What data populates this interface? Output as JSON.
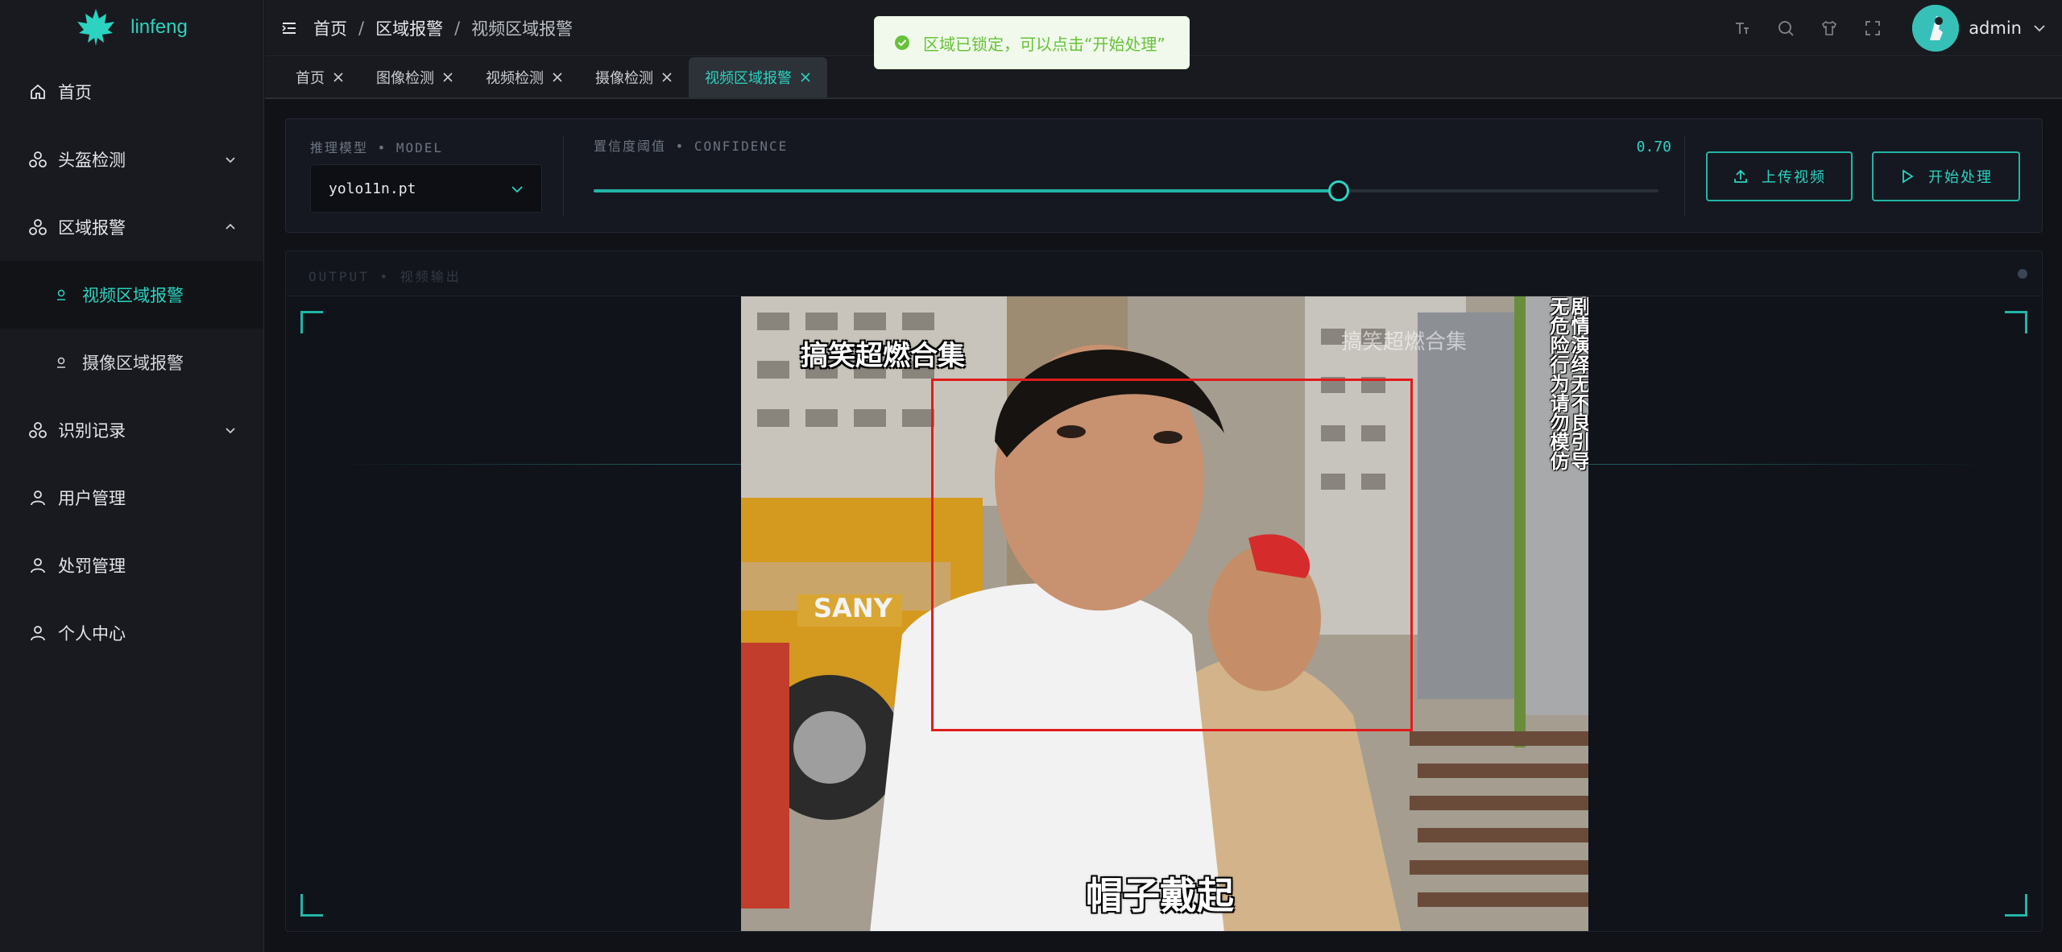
{
  "app": {
    "name": "linfeng",
    "accent": "#2bd3c0"
  },
  "sidebar": {
    "items": [
      {
        "label": "首页",
        "icon": "home-icon"
      },
      {
        "label": "头盔检测",
        "icon": "cluster-icon",
        "expandable": true,
        "expanded": false
      },
      {
        "label": "区域报警",
        "icon": "cluster-icon",
        "expandable": true,
        "expanded": true,
        "children": [
          {
            "label": "视频区域报警",
            "active": true
          },
          {
            "label": "摄像区域报警",
            "active": false
          }
        ]
      },
      {
        "label": "识别记录",
        "icon": "cluster-icon",
        "expandable": true,
        "expanded": false
      },
      {
        "label": "用户管理",
        "icon": "user-icon"
      },
      {
        "label": "处罚管理",
        "icon": "user-icon"
      },
      {
        "label": "个人中心",
        "icon": "user-icon"
      }
    ]
  },
  "header": {
    "breadcrumb": [
      "首页",
      "区域报警",
      "视频区域报警"
    ],
    "separator": "/",
    "user": "admin"
  },
  "toast": {
    "message": "区域已锁定，可以点击“开始处理”",
    "type": "success"
  },
  "tabs": [
    {
      "label": "首页",
      "active": false
    },
    {
      "label": "图像检测",
      "active": false
    },
    {
      "label": "视频检测",
      "active": false
    },
    {
      "label": "摄像检测",
      "active": false
    },
    {
      "label": "视频区域报警",
      "active": true
    }
  ],
  "controls": {
    "model_label": "推理模型 • MODEL",
    "model_value": "yolo11n.pt",
    "confidence_label": "置信度阈值 • CONFIDENCE",
    "confidence_value": "0.70",
    "confidence": 0.7,
    "upload_label": "上传视频",
    "start_label": "开始处理"
  },
  "output": {
    "title": "OUTPUT • 视频输出",
    "video": {
      "title_overlay": "搞笑超燃合集",
      "watermark": "搞笑超燃合集",
      "side_text_1": "剧情演绎无不良引导",
      "side_text_2": "无危险行为请勿模仿",
      "caption": "帽子戴起",
      "sign_text": "SANY"
    }
  }
}
